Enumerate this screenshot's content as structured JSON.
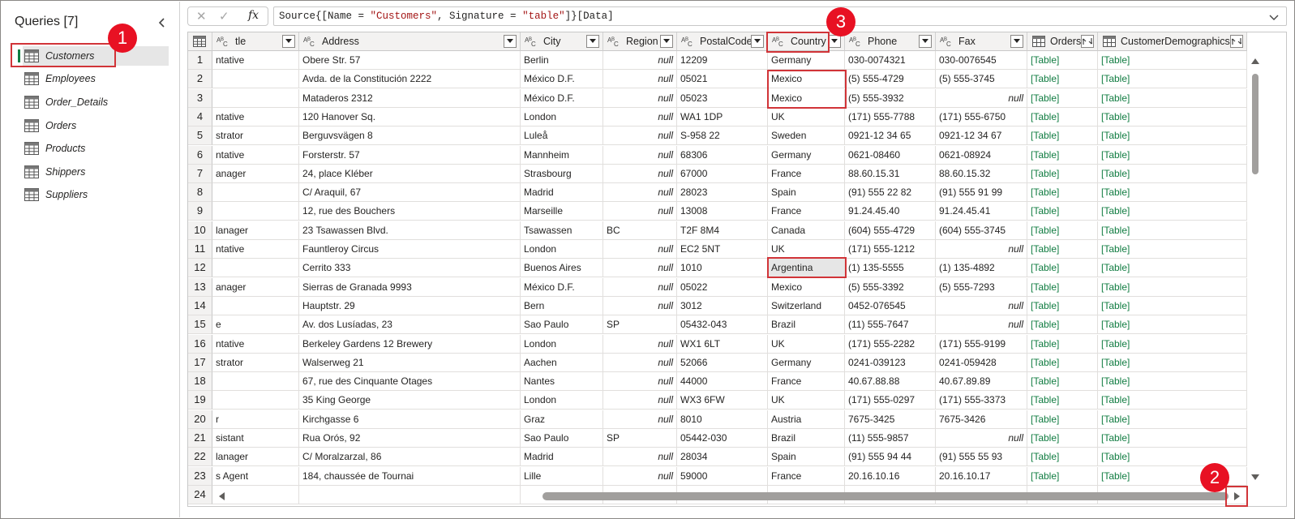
{
  "sidebar": {
    "title": "Queries [7]",
    "items": [
      {
        "label": "Customers",
        "selected": true
      },
      {
        "label": "Employees"
      },
      {
        "label": "Order_Details"
      },
      {
        "label": "Orders"
      },
      {
        "label": "Products"
      },
      {
        "label": "Shippers"
      },
      {
        "label": "Suppliers"
      }
    ]
  },
  "formula": {
    "fx_label": "fx",
    "text_parts": [
      "Source{[Name = ",
      "\"Customers\"",
      ", Signature = ",
      "\"table\"",
      "]}[Data]"
    ]
  },
  "columns": [
    {
      "label": "tle",
      "type": "ABC",
      "filter": "dropdown"
    },
    {
      "label": "Address",
      "type": "ABC",
      "filter": "dropdown"
    },
    {
      "label": "City",
      "type": "ABC",
      "filter": "dropdown"
    },
    {
      "label": "Region",
      "type": "ABC",
      "filter": "dropdown"
    },
    {
      "label": "PostalCode",
      "type": "ABC",
      "filter": "dropdown"
    },
    {
      "label": "Country",
      "type": "ABC",
      "filter": "dropdown"
    },
    {
      "label": "Phone",
      "type": "ABC",
      "filter": "dropdown"
    },
    {
      "label": "Fax",
      "type": "ABC",
      "filter": "dropdown"
    },
    {
      "label": "Orders",
      "type": "table",
      "filter": "expand"
    },
    {
      "label": "CustomerDemographics",
      "type": "table",
      "filter": "expand"
    }
  ],
  "rows": [
    [
      "ntative",
      "Obere Str. 57",
      "Berlin",
      "null",
      "12209",
      "Germany",
      "030-0074321",
      "030-0076545",
      "[Table]",
      "[Table]"
    ],
    [
      "",
      "Avda. de la Constitución 2222",
      "México D.F.",
      "null",
      "05021",
      "Mexico",
      "(5) 555-4729",
      "(5) 555-3745",
      "[Table]",
      "[Table]"
    ],
    [
      "",
      "Mataderos  2312",
      "México D.F.",
      "null",
      "05023",
      "Mexico",
      "(5) 555-3932",
      "null",
      "[Table]",
      "[Table]"
    ],
    [
      "ntative",
      "120 Hanover Sq.",
      "London",
      "null",
      "WA1 1DP",
      "UK",
      "(171) 555-7788",
      "(171) 555-6750",
      "[Table]",
      "[Table]"
    ],
    [
      "strator",
      "Berguvsvägen  8",
      "Luleå",
      "null",
      "S-958 22",
      "Sweden",
      "0921-12 34 65",
      "0921-12 34 67",
      "[Table]",
      "[Table]"
    ],
    [
      "ntative",
      "Forsterstr. 57",
      "Mannheim",
      "null",
      "68306",
      "Germany",
      "0621-08460",
      "0621-08924",
      "[Table]",
      "[Table]"
    ],
    [
      "anager",
      "24, place Kléber",
      "Strasbourg",
      "null",
      "67000",
      "France",
      "88.60.15.31",
      "88.60.15.32",
      "[Table]",
      "[Table]"
    ],
    [
      "",
      "C/ Araquil, 67",
      "Madrid",
      "null",
      "28023",
      "Spain",
      "(91) 555 22 82",
      "(91) 555 91 99",
      "[Table]",
      "[Table]"
    ],
    [
      "",
      "12, rue des Bouchers",
      "Marseille",
      "null",
      "13008",
      "France",
      "91.24.45.40",
      "91.24.45.41",
      "[Table]",
      "[Table]"
    ],
    [
      "lanager",
      "23 Tsawassen Blvd.",
      "Tsawassen",
      "BC",
      "T2F 8M4",
      "Canada",
      "(604) 555-4729",
      "(604) 555-3745",
      "[Table]",
      "[Table]"
    ],
    [
      "ntative",
      "Fauntleroy Circus",
      "London",
      "null",
      "EC2 5NT",
      "UK",
      "(171) 555-1212",
      "null",
      "[Table]",
      "[Table]"
    ],
    [
      "",
      "Cerrito 333",
      "Buenos Aires",
      "null",
      "1010",
      "Argentina",
      "(1) 135-5555",
      "(1) 135-4892",
      "[Table]",
      "[Table]"
    ],
    [
      "anager",
      "Sierras de Granada 9993",
      "México D.F.",
      "null",
      "05022",
      "Mexico",
      "(5) 555-3392",
      "(5) 555-7293",
      "[Table]",
      "[Table]"
    ],
    [
      "",
      "Hauptstr. 29",
      "Bern",
      "null",
      "3012",
      "Switzerland",
      "0452-076545",
      "null",
      "[Table]",
      "[Table]"
    ],
    [
      "e",
      "Av. dos Lusíadas, 23",
      "Sao Paulo",
      "SP",
      "05432-043",
      "Brazil",
      "(11) 555-7647",
      "null",
      "[Table]",
      "[Table]"
    ],
    [
      "ntative",
      "Berkeley Gardens 12  Brewery",
      "London",
      "null",
      "WX1 6LT",
      "UK",
      "(171) 555-2282",
      "(171) 555-9199",
      "[Table]",
      "[Table]"
    ],
    [
      "strator",
      "Walserweg 21",
      "Aachen",
      "null",
      "52066",
      "Germany",
      "0241-039123",
      "0241-059428",
      "[Table]",
      "[Table]"
    ],
    [
      "",
      "67, rue des Cinquante Otages",
      "Nantes",
      "null",
      "44000",
      "France",
      "40.67.88.88",
      "40.67.89.89",
      "[Table]",
      "[Table]"
    ],
    [
      "",
      "35 King George",
      "London",
      "null",
      "WX3 6FW",
      "UK",
      "(171) 555-0297",
      "(171) 555-3373",
      "[Table]",
      "[Table]"
    ],
    [
      "r",
      "Kirchgasse 6",
      "Graz",
      "null",
      "8010",
      "Austria",
      "7675-3425",
      "7675-3426",
      "[Table]",
      "[Table]"
    ],
    [
      "sistant",
      "Rua Orós, 92",
      "Sao Paulo",
      "SP",
      "05442-030",
      "Brazil",
      "(11) 555-9857",
      "null",
      "[Table]",
      "[Table]"
    ],
    [
      "lanager",
      "C/ Moralzarzal, 86",
      "Madrid",
      "null",
      "28034",
      "Spain",
      "(91) 555 94 44",
      "(91) 555 55 93",
      "[Table]",
      "[Table]"
    ],
    [
      "s Agent",
      "184, chaussée de Tournai",
      "Lille",
      "null",
      "59000",
      "France",
      "20.16.10.16",
      "20.16.10.17",
      "[Table]",
      "[Table]"
    ],
    [
      "",
      "",
      "",
      "",
      "",
      "",
      "",
      "",
      "",
      ""
    ]
  ],
  "row_numbers": [
    "1",
    "2",
    "3",
    "4",
    "5",
    "6",
    "7",
    "8",
    "9",
    "10",
    "11",
    "12",
    "13",
    "14",
    "15",
    "16",
    "17",
    "18",
    "19",
    "20",
    "21",
    "22",
    "23",
    "24"
  ],
  "callouts": [
    "1",
    "2",
    "3"
  ],
  "colors": {
    "accent": "#107c41",
    "callout": "#e81123",
    "highlight": "#d13438"
  }
}
